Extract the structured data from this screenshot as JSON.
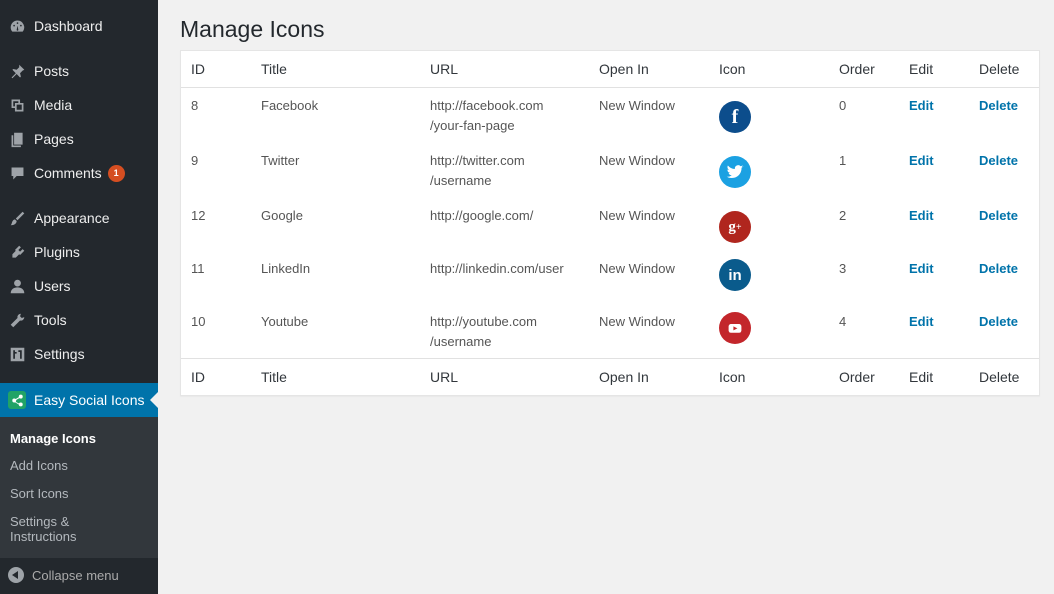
{
  "sidebar": {
    "items": [
      {
        "label": "Dashboard",
        "icon": "dashboard-icon"
      },
      {
        "label": "Posts",
        "icon": "pushpin-icon"
      },
      {
        "label": "Media",
        "icon": "media-icon"
      },
      {
        "label": "Pages",
        "icon": "pages-icon"
      },
      {
        "label": "Comments",
        "icon": "comment-icon",
        "badge": "1"
      },
      {
        "label": "Appearance",
        "icon": "paintbrush-icon"
      },
      {
        "label": "Plugins",
        "icon": "plugin-icon"
      },
      {
        "label": "Users",
        "icon": "user-icon"
      },
      {
        "label": "Tools",
        "icon": "wrench-icon"
      },
      {
        "label": "Settings",
        "icon": "settings-icon"
      },
      {
        "label": "Easy Social Icons",
        "icon": "share-icon",
        "current": true
      }
    ],
    "submenu": [
      {
        "label": "Manage Icons",
        "active": true
      },
      {
        "label": "Add Icons"
      },
      {
        "label": "Sort Icons"
      },
      {
        "label": "Settings & Instructions"
      }
    ],
    "collapse_label": "Collapse menu"
  },
  "page": {
    "title": "Manage Icons"
  },
  "table": {
    "columns": [
      "ID",
      "Title",
      "URL",
      "Open In",
      "Icon",
      "Order",
      "Edit",
      "Delete"
    ],
    "rows": [
      {
        "id": "8",
        "title": "Facebook",
        "url1": "http://facebook.com",
        "url2": "/your-fan-page",
        "open_in": "New Window",
        "icon": "facebook-icon",
        "icon_color": "#0c4d8c",
        "order": "0",
        "edit": "Edit",
        "delete": "Delete"
      },
      {
        "id": "9",
        "title": "Twitter",
        "url1": "http://twitter.com",
        "url2": "/username",
        "open_in": "New Window",
        "icon": "twitter-icon",
        "icon_color": "#1ba1e2",
        "order": "1",
        "edit": "Edit",
        "delete": "Delete"
      },
      {
        "id": "12",
        "title": "Google",
        "url1": "http://google.com/",
        "url2": "",
        "open_in": "New Window",
        "icon": "google-plus-icon",
        "icon_color": "#b0261e",
        "order": "2",
        "edit": "Edit",
        "delete": "Delete"
      },
      {
        "id": "11",
        "title": "LinkedIn",
        "url1": "http://linkedin.com/user",
        "url2": "",
        "open_in": "New Window",
        "icon": "linkedin-icon",
        "icon_color": "#0a5b8c",
        "order": "3",
        "edit": "Edit",
        "delete": "Delete"
      },
      {
        "id": "10",
        "title": "Youtube",
        "url1": "http://youtube.com",
        "url2": "/username",
        "open_in": "New Window",
        "icon": "youtube-icon",
        "icon_color": "#c3262b",
        "order": "4",
        "edit": "Edit",
        "delete": "Delete"
      }
    ]
  },
  "colors": {
    "sidebar_bg": "#23282d",
    "accent": "#0073aa",
    "badge": "#d54e21"
  }
}
